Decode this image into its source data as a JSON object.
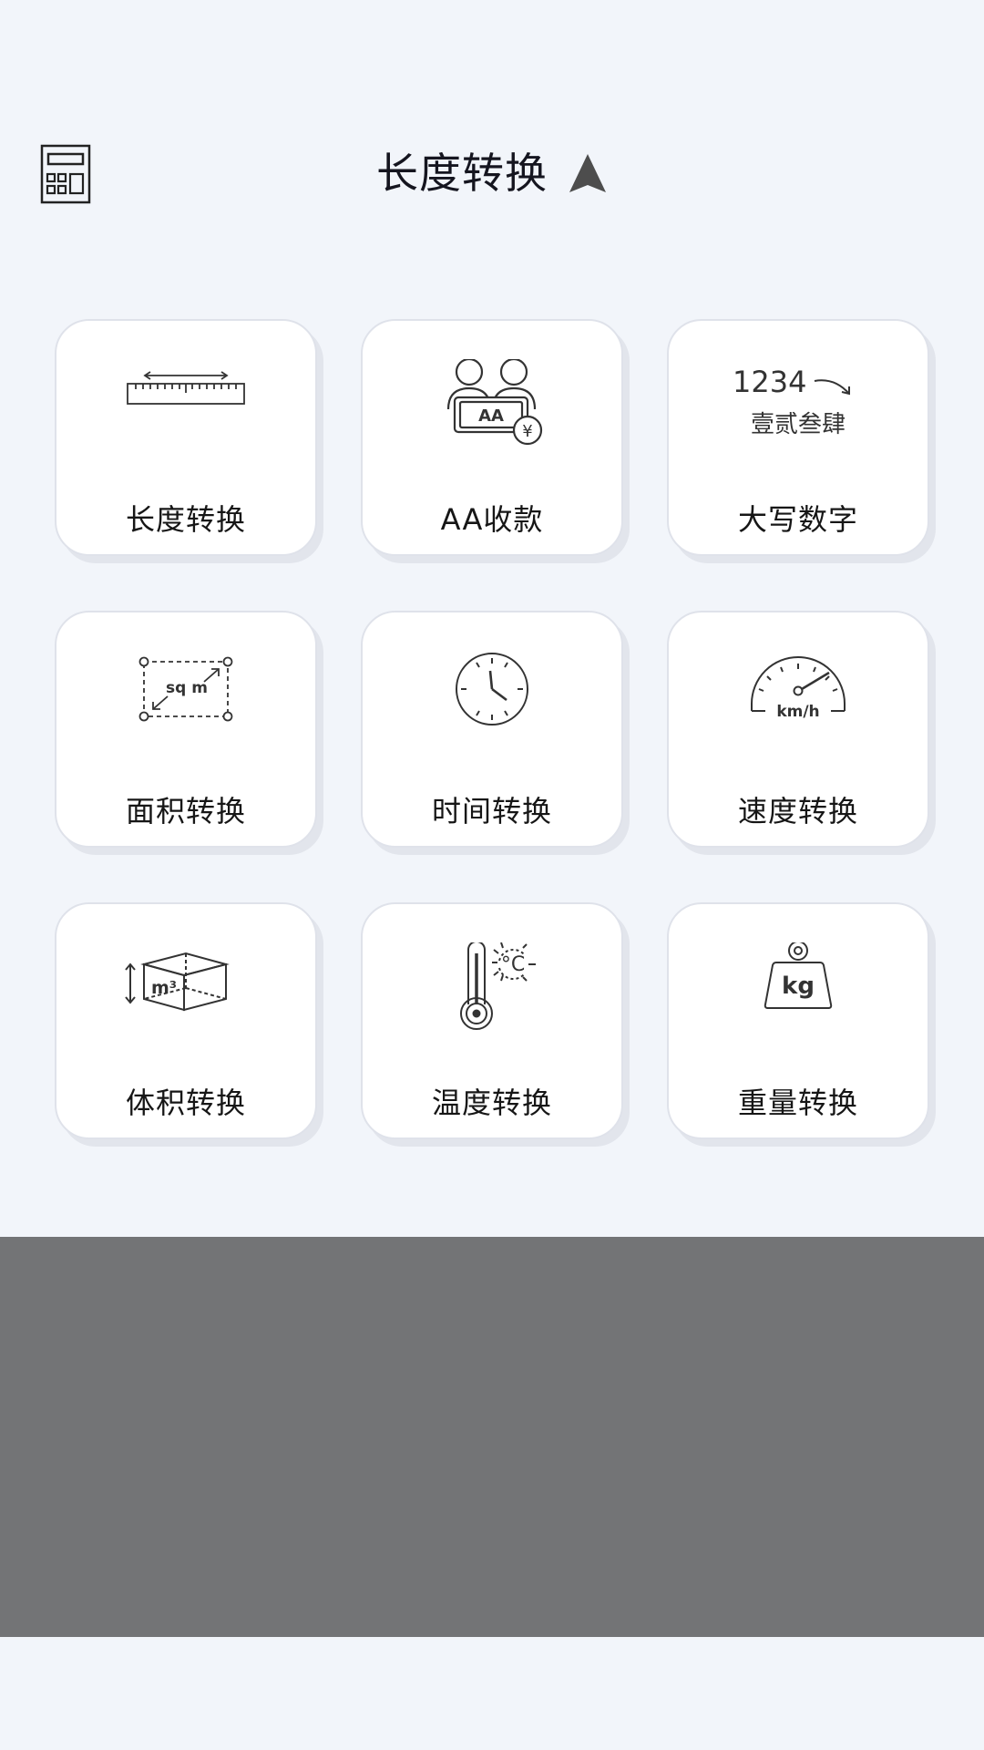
{
  "header": {
    "title": "长度转换",
    "calculator_icon": "calculator-icon",
    "navigate_icon": "navigation-arrow-icon"
  },
  "tools": [
    {
      "label": "长度转换",
      "icon": "ruler-icon"
    },
    {
      "label": "AA收款",
      "icon": "aa-payment-icon"
    },
    {
      "label": "大写数字",
      "icon": "uppercase-number-icon",
      "icon_text_top": "1234",
      "icon_text_bottom": "壹贰叁肆"
    },
    {
      "label": "面积转换",
      "icon": "area-icon",
      "icon_text": "sq m"
    },
    {
      "label": "时间转换",
      "icon": "clock-icon"
    },
    {
      "label": "速度转换",
      "icon": "speedometer-icon",
      "icon_text": "km/h"
    },
    {
      "label": "体积转换",
      "icon": "volume-cube-icon",
      "icon_text": "m³"
    },
    {
      "label": "温度转换",
      "icon": "thermometer-icon",
      "icon_text": "°C"
    },
    {
      "label": "重量转换",
      "icon": "weight-icon",
      "icon_text": "kg"
    }
  ],
  "colors": {
    "background": "#f2f5fa",
    "card": "#ffffff",
    "ad_placeholder": "#737476",
    "icon_stroke": "#333333"
  }
}
